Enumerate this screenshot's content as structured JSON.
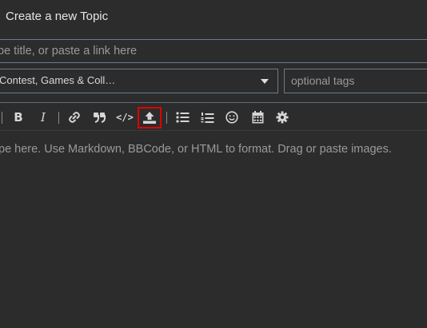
{
  "header": {
    "title": "Create a new Topic"
  },
  "title_field": {
    "placeholder": "pe title, or paste a link here"
  },
  "category_select": {
    "value": "Contest, Games & Coll…"
  },
  "tags_field": {
    "placeholder": "optional tags"
  },
  "toolbar": {
    "bold_label": "B",
    "italic_label": "I",
    "code_label": "</>",
    "icons": [
      "bold-icon",
      "italic-icon",
      "link-icon",
      "quote-icon",
      "code-icon",
      "upload-icon",
      "bullet-list-icon",
      "numbered-list-icon",
      "emoji-icon",
      "calendar-icon",
      "gear-icon"
    ],
    "highlight_color": "#e00000"
  },
  "composer": {
    "placeholder": "pe here. Use Markdown, BBCode, or HTML to format. Drag or paste images."
  },
  "colors": {
    "background": "#2c2c2c",
    "border": "#6b7a8a",
    "text": "#dddddd",
    "placeholder": "#9a9a9a"
  }
}
